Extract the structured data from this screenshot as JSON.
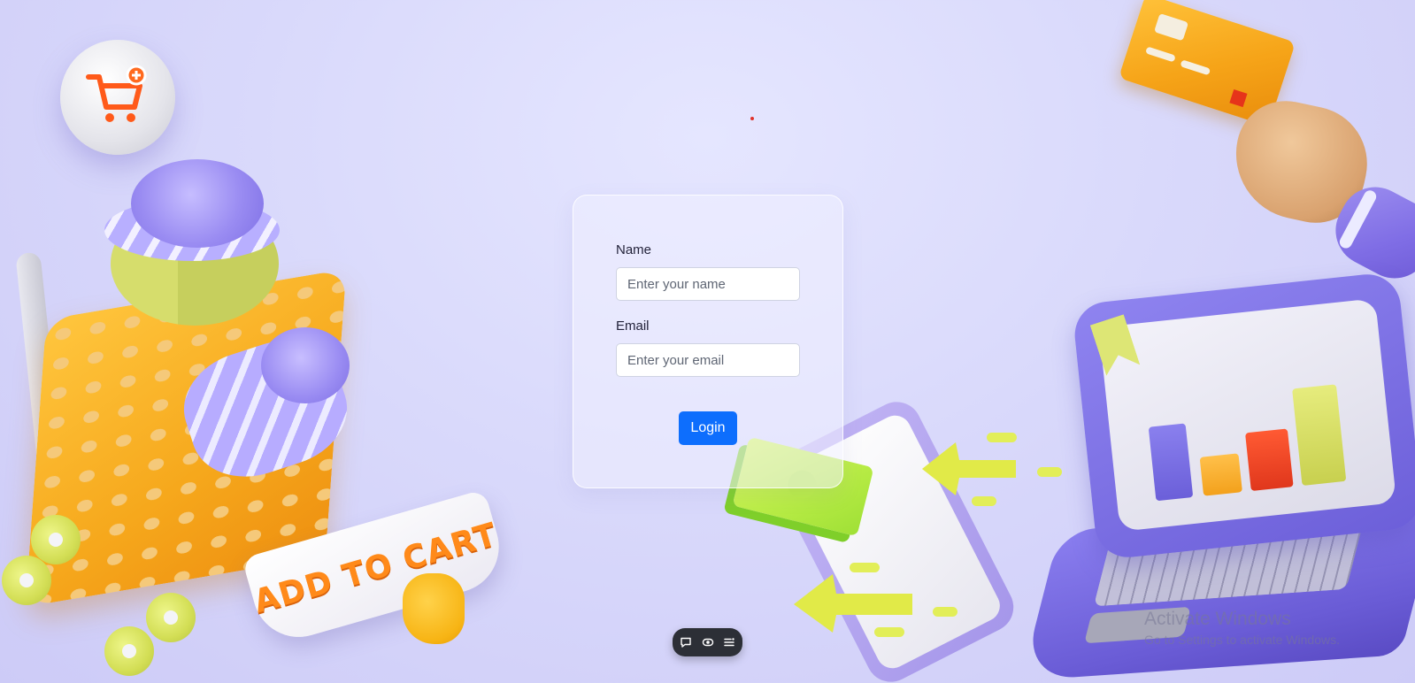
{
  "form": {
    "name_label": "Name",
    "name_placeholder": "Enter your name",
    "email_label": "Email",
    "email_placeholder": "Enter your email",
    "login_label": "Login",
    "accent_color": "#0d6efd"
  },
  "illustrations": {
    "add_to_cart_text": "ADD TO CART"
  },
  "toolbar": {
    "icons": [
      "chat-icon",
      "eye-icon",
      "list-icon"
    ]
  },
  "watermark": {
    "title": "Activate Windows",
    "subtitle": "Go to Settings to activate Windows."
  }
}
